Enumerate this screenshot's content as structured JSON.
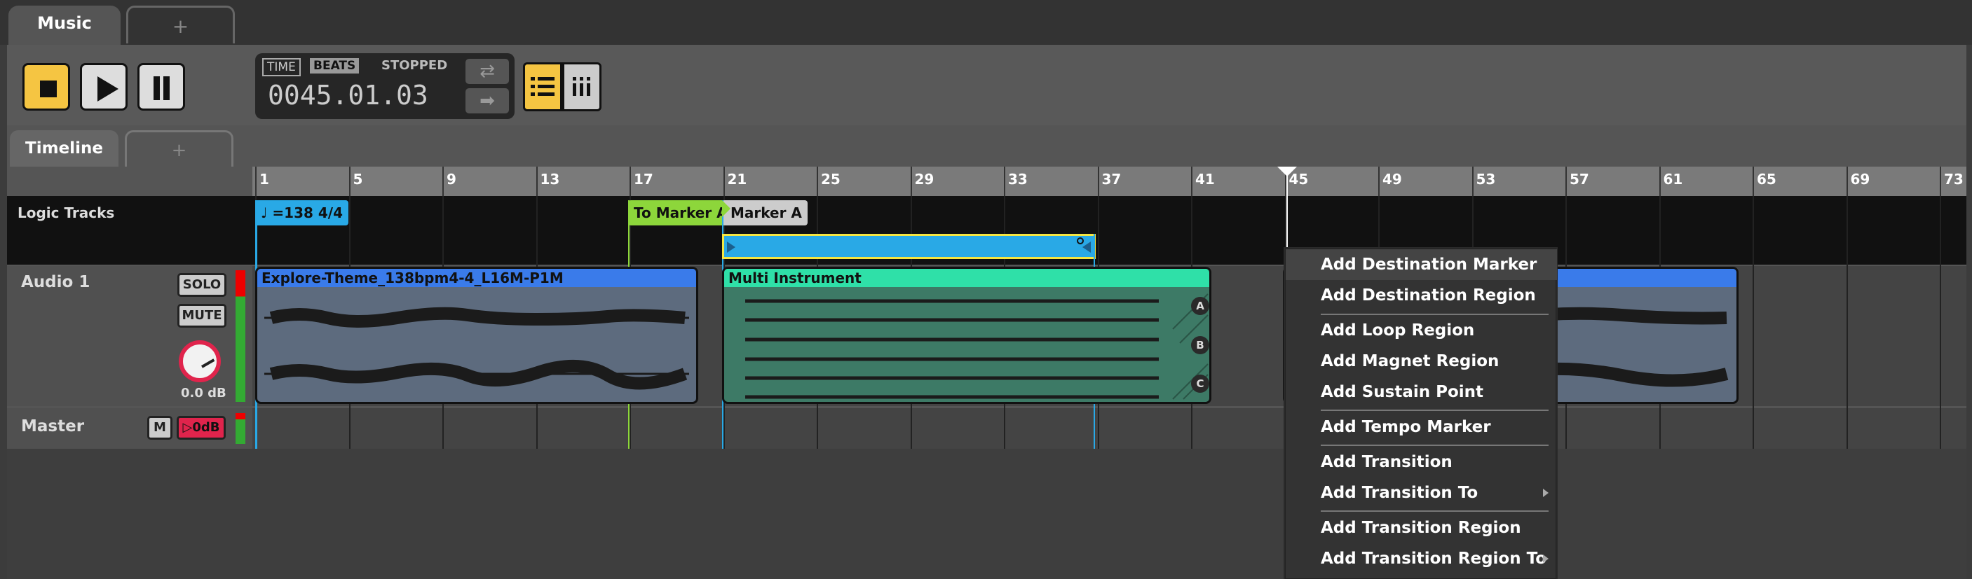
{
  "tabs": {
    "active": "Music",
    "add": "+"
  },
  "transport": {
    "time_tag": "TIME",
    "beats_tag": "BEATS",
    "status": "STOPPED",
    "position": "0045.01.03"
  },
  "timeline_tabs": {
    "active": "Timeline",
    "add": "+"
  },
  "ruler": {
    "ticks": [
      "1",
      "5",
      "9",
      "13",
      "17",
      "21",
      "25",
      "29",
      "33",
      "37",
      "41",
      "45",
      "49",
      "53",
      "57",
      "61",
      "65",
      "69",
      "73"
    ]
  },
  "logic_tracks": {
    "label": "Logic Tracks",
    "tempo_marker": "=138 4/4",
    "to_marker": "To Marker A",
    "marker_a": "Marker A"
  },
  "tracks": [
    {
      "name": "Audio 1",
      "solo": "SOLO",
      "mute": "MUTE",
      "gain": "0.0 dB"
    },
    {
      "name": "Master",
      "mute": "M",
      "gain": "0dB"
    }
  ],
  "clips": {
    "explore": "Explore-Theme_138bpm4-4_L16M-P1M",
    "multi": "Multi Instrument",
    "multi_lanes": [
      "A",
      "B",
      "C"
    ]
  },
  "context_menu": {
    "items": [
      "Add Destination Marker",
      "Add Destination Region",
      "Add Loop Region",
      "Add Magnet Region",
      "Add Sustain Point",
      "Add Tempo Marker",
      "Add Transition",
      "Add Transition To",
      "Add Transition Region",
      "Add Transition Region To"
    ]
  },
  "colors": {
    "accent_yellow": "#f5c542",
    "clip_blue": "#3a7bea",
    "clip_teal": "#2fe0a8",
    "marker_green": "#8dd63b",
    "tempo_blue": "#29a9e6",
    "region_yellow": "#f5e642",
    "knob_red": "#e0244c"
  }
}
